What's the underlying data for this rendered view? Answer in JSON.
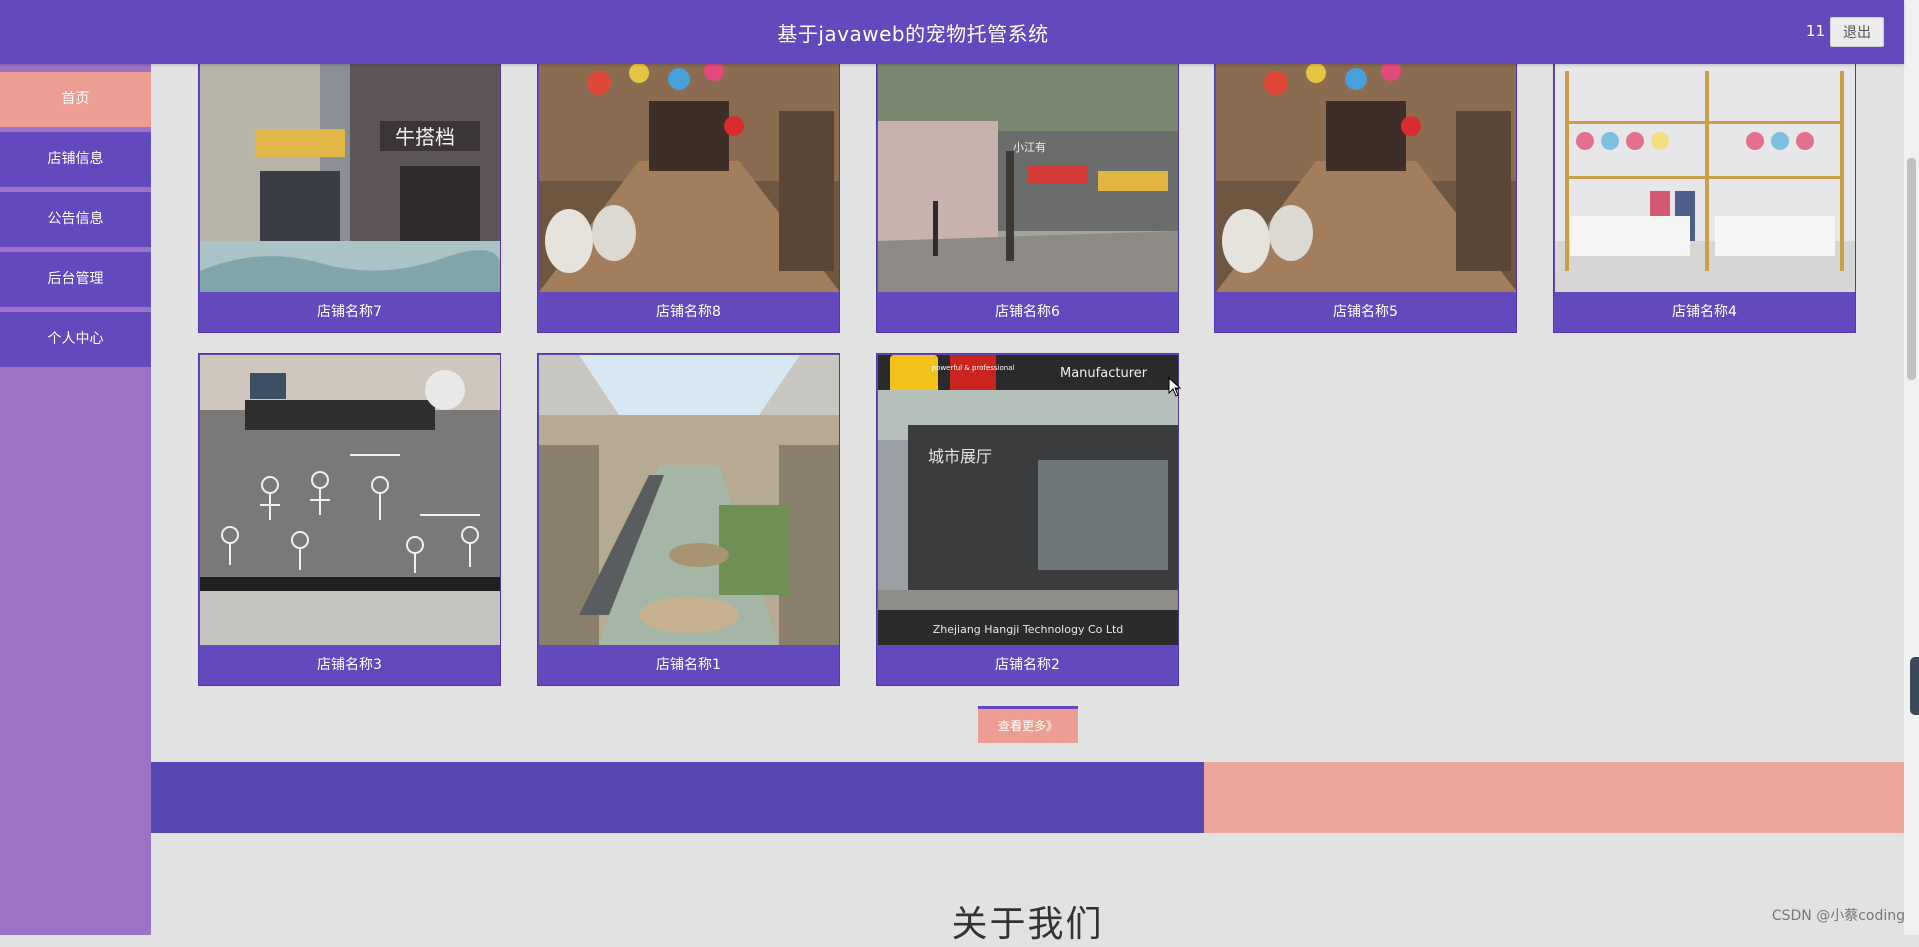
{
  "header": {
    "title": "基于javaweb的宠物托管系统",
    "user": "11",
    "logout_label": "退出",
    "bg_color": "#6448bd"
  },
  "sidebar": {
    "items": [
      {
        "label": "首页",
        "active": true
      },
      {
        "label": "店铺信息",
        "active": false
      },
      {
        "label": "公告信息",
        "active": false
      },
      {
        "label": "后台管理",
        "active": false
      },
      {
        "label": "个人中心",
        "active": false
      }
    ],
    "active_color": "#ec9e93",
    "item_color": "#6448bd"
  },
  "shops": [
    {
      "name": "店铺名称7"
    },
    {
      "name": "店铺名称8"
    },
    {
      "name": "店铺名称6"
    },
    {
      "name": "店铺名称5"
    },
    {
      "name": "店铺名称4"
    },
    {
      "name": "店铺名称3"
    },
    {
      "name": "店铺名称1"
    },
    {
      "name": "店铺名称2"
    }
  ],
  "image_text": {
    "shop7_sign": "牛搭档",
    "shop6_sign": "小江有",
    "shop2_top": "Manufacturer",
    "shop2_badge": "powerful & professional",
    "shop2_hall": "城市展厅",
    "shop2_footer": "Zhejiang Hangji Technology Co Ltd"
  },
  "more_label": "查看更多》",
  "about": {
    "title": "关于我们"
  },
  "watermark": "CSDN @小蔡coding",
  "colors": {
    "page_bg": "#e3e2e3",
    "band_left": "#5747b5",
    "band_right": "#eba79a"
  }
}
